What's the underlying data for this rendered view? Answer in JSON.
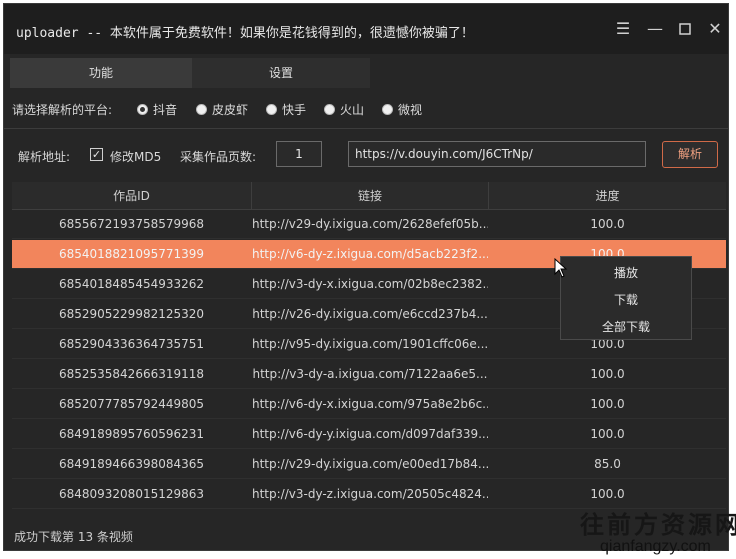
{
  "window": {
    "title": "uploader -- 本软件属于免费软件！如果你是花钱得到的，很遗憾你被骗了！",
    "controls": {
      "menu_icon": "hamburger-icon",
      "minimize_icon": "minimize-icon",
      "maximize_icon": "maximize-icon",
      "close_icon": "close-icon"
    }
  },
  "tabs": [
    {
      "label": "功能",
      "active": true
    },
    {
      "label": "设置",
      "active": false
    }
  ],
  "platform": {
    "label": "请选择解析的平台:",
    "options": [
      {
        "label": "抖音",
        "checked": true
      },
      {
        "label": "皮皮虾",
        "checked": false
      },
      {
        "label": "快手",
        "checked": false
      },
      {
        "label": "火山",
        "checked": false
      },
      {
        "label": "微视",
        "checked": false
      }
    ]
  },
  "parse": {
    "address_label": "解析地址:",
    "modify_md5_label": "修改MD5",
    "modify_md5_checked": true,
    "pages_label": "采集作品页数:",
    "pages_value": "1",
    "url_value": "https://v.douyin.com/J6CTrNp/",
    "parse_button": "解析"
  },
  "table": {
    "columns": [
      "作品ID",
      "链接",
      "进度"
    ],
    "rows": [
      {
        "id": "6855672193758579968",
        "link": "http://v29-dy.ixigua.com/2628efef05b...",
        "progress": "100.0",
        "selected": false
      },
      {
        "id": "6854018821095771399",
        "link": "http://v6-dy-z.ixigua.com/d5acb223f2...",
        "progress": "100.0",
        "selected": true
      },
      {
        "id": "6854018485454933262",
        "link": "http://v3-dy-x.ixigua.com/02b8ec2382...",
        "progress": "100.0",
        "selected": false
      },
      {
        "id": "6852905229982125320",
        "link": "http://v26-dy.ixigua.com/e6ccd237b4...",
        "progress": "100.0",
        "selected": false
      },
      {
        "id": "6852904336364735751",
        "link": "http://v95-dy.ixigua.com/1901cffc06e...",
        "progress": "100.0",
        "selected": false
      },
      {
        "id": "6852535842666319118",
        "link": "http://v3-dy-a.ixigua.com/7122aa6e5...",
        "progress": "100.0",
        "selected": false
      },
      {
        "id": "6852077785792449805",
        "link": "http://v6-dy-x.ixigua.com/975a8e2b6c...",
        "progress": "100.0",
        "selected": false
      },
      {
        "id": "6849189895760596231",
        "link": "http://v6-dy-y.ixigua.com/d097daf339...",
        "progress": "100.0",
        "selected": false
      },
      {
        "id": "6849189466398084365",
        "link": "http://v29-dy.ixigua.com/e00ed17b84...",
        "progress": "85.0",
        "selected": false
      },
      {
        "id": "6848093208015129863",
        "link": "http://v3-dy-z.ixigua.com/20505c4824...",
        "progress": "100.0",
        "selected": false
      }
    ]
  },
  "context_menu": {
    "items": [
      "播放",
      "下载",
      "全部下载"
    ]
  },
  "status": {
    "text": "成功下载第 13 条视频"
  },
  "watermark": {
    "main": "往前方资源网",
    "sub": "qianfangzy.com"
  },
  "colors": {
    "selected_row": "#f2855c",
    "parse_button_border": "#d06a48",
    "background": "#262626"
  }
}
